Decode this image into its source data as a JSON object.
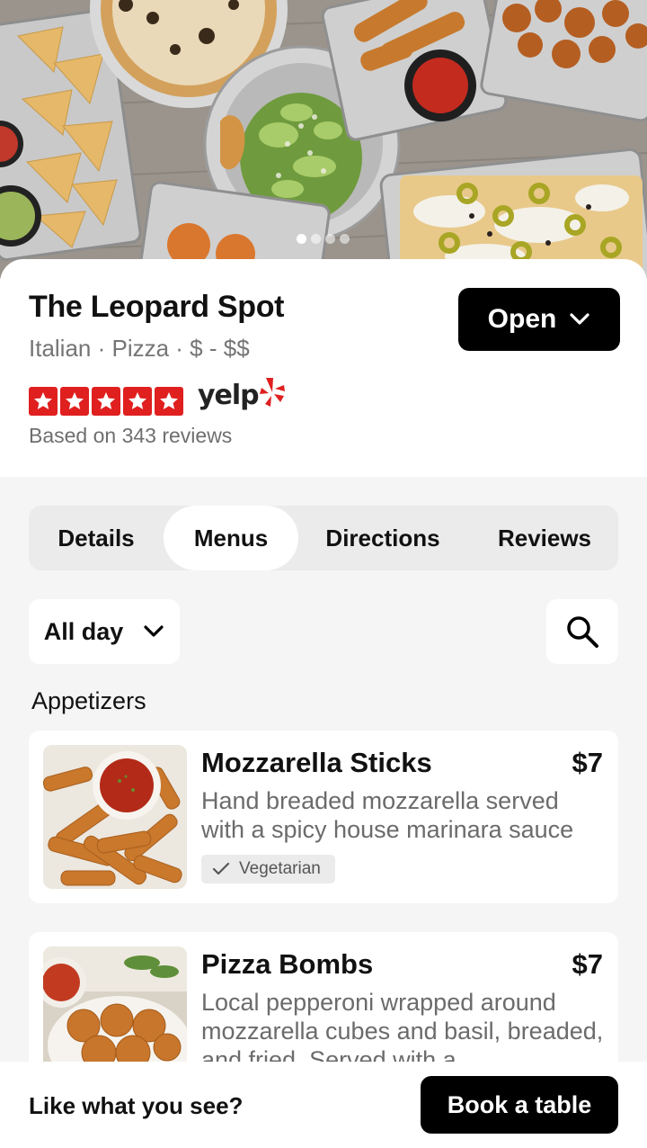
{
  "hero": {
    "image_icon": "food-spread-photo",
    "carousel": {
      "total": 4,
      "active_index": 0
    }
  },
  "restaurant": {
    "name": "The Leopard Spot",
    "subtitle": "Italian · Pizza · $ - $$",
    "status_label": "Open",
    "rating": 5,
    "rating_max": 5,
    "rating_source": "yelp",
    "reviews_text": "Based on 343 reviews"
  },
  "tabs": [
    {
      "label": "Details",
      "active": false
    },
    {
      "label": "Menus",
      "active": true
    },
    {
      "label": "Directions",
      "active": false
    },
    {
      "label": "Reviews",
      "active": false
    }
  ],
  "filter": {
    "selected": "All day"
  },
  "section_title": "Appetizers",
  "menu_items": [
    {
      "title": "Mozzarella Sticks",
      "price": "$7",
      "description": "Hand breaded mozzarella served with a spicy house marinara sauce",
      "tag": "Vegetarian",
      "image_icon": "mozzarella-sticks-photo"
    },
    {
      "title": "Pizza Bombs",
      "price": "$7",
      "description": "Local pepperoni wrapped around mozzarella cubes and basil, breaded, and fried. Served with a",
      "image_icon": "pizza-bombs-photo"
    }
  ],
  "bottom_bar": {
    "prompt": "Like what you see?",
    "button_label": "Book a table"
  },
  "colors": {
    "accent": "#000000",
    "yelp_red": "#e01f1f",
    "background": "#f5f5f5"
  }
}
